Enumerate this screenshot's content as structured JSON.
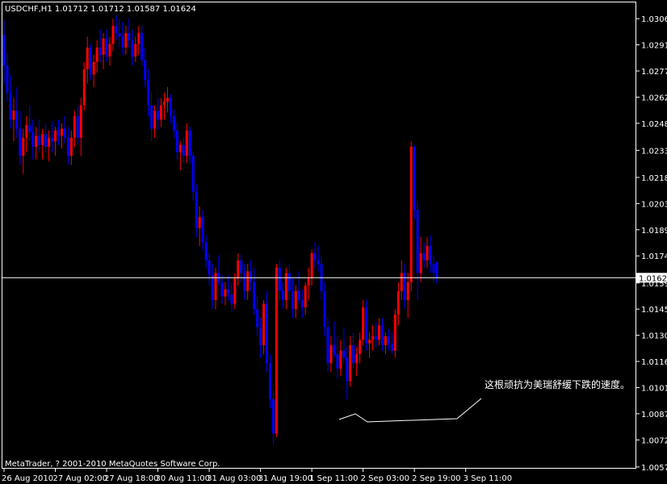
{
  "header": {
    "title": "USDCHF,H1  1.01712 1.01712 1.01587 1.01624"
  },
  "footer": {
    "copyright": "MetaTrader, ? 2001-2010 MetaQuotes Software Corp."
  },
  "annotation": {
    "text": "这根顽抗为美瑞舒缓下跌的速度。"
  },
  "colors": {
    "background": "#000000",
    "frame": "#ffffff",
    "bull": "#ff0000",
    "bear": "#0000ff",
    "bid_line": "#ffffff"
  },
  "chart_data": {
    "type": "candlestick",
    "symbol": "USDCHF",
    "timeframe": "H1",
    "quote": {
      "open": 1.01712,
      "high": 1.01712,
      "low": 1.01587,
      "close": 1.01624
    },
    "current_price_label": "1.01624",
    "ylim": [
      1.0057,
      1.0315
    ],
    "yticks": [
      "1.03060",
      "1.02915",
      "1.02770",
      "1.02625",
      "1.02480",
      "1.02330",
      "1.02180",
      "1.02035",
      "1.01890",
      "1.01745",
      "1.01595",
      "1.01450",
      "1.01305",
      "1.01160",
      "1.01015",
      "1.00870",
      "1.00725",
      "1.00575"
    ],
    "xticks": [
      "26 Aug 2010",
      "27 Aug 02:00",
      "27 Aug 18:00",
      "30 Aug 11:00",
      "31 Aug 03:00",
      "31 Aug 19:00",
      "1 Sep 11:00",
      "2 Sep 03:00",
      "2 Sep 19:00",
      "3 Sep 11:00"
    ],
    "bars_between_xticks": 16,
    "candles": [
      [
        1.0297,
        1.0305,
        1.027,
        1.028
      ],
      [
        1.028,
        1.0287,
        1.026,
        1.0265
      ],
      [
        1.0265,
        1.0275,
        1.0245,
        1.025
      ],
      [
        1.025,
        1.0262,
        1.0238,
        1.0255
      ],
      [
        1.0255,
        1.0268,
        1.024,
        1.0245
      ],
      [
        1.0245,
        1.0255,
        1.0225,
        1.023
      ],
      [
        1.023,
        1.0245,
        1.022,
        1.024
      ],
      [
        1.024,
        1.0252,
        1.0232,
        1.0247
      ],
      [
        1.0247,
        1.0258,
        1.0238,
        1.0243
      ],
      [
        1.0243,
        1.025,
        1.0228,
        1.0235
      ],
      [
        1.0235,
        1.0246,
        1.0228,
        1.0241
      ],
      [
        1.0241,
        1.025,
        1.0232,
        1.0236
      ],
      [
        1.0236,
        1.0245,
        1.0228,
        1.0242
      ],
      [
        1.0242,
        1.0248,
        1.0232,
        1.0235
      ],
      [
        1.0235,
        1.0244,
        1.0227,
        1.024
      ],
      [
        1.024,
        1.0249,
        1.0232,
        1.0238
      ],
      [
        1.0238,
        1.0246,
        1.023,
        1.0244
      ],
      [
        1.0244,
        1.025,
        1.0236,
        1.0241
      ],
      [
        1.0241,
        1.0248,
        1.0234,
        1.0245
      ],
      [
        1.0245,
        1.0252,
        1.0237,
        1.024
      ],
      [
        1.024,
        1.0246,
        1.0225,
        1.023
      ],
      [
        1.023,
        1.0244,
        1.0225,
        1.024
      ],
      [
        1.024,
        1.0255,
        1.0235,
        1.0252
      ],
      [
        1.0252,
        1.0258,
        1.0236,
        1.024
      ],
      [
        1.024,
        1.0262,
        1.023,
        1.0258
      ],
      [
        1.0258,
        1.0282,
        1.0255,
        1.0278
      ],
      [
        1.0278,
        1.0296,
        1.027,
        1.029
      ],
      [
        1.029,
        1.0292,
        1.0272,
        1.0275
      ],
      [
        1.0275,
        1.0286,
        1.0268,
        1.0282
      ],
      [
        1.0282,
        1.0294,
        1.0276,
        1.029
      ],
      [
        1.029,
        1.03,
        1.0282,
        1.0286
      ],
      [
        1.0286,
        1.0298,
        1.0278,
        1.0295
      ],
      [
        1.0295,
        1.03,
        1.0282,
        1.0285
      ],
      [
        1.0285,
        1.0296,
        1.028,
        1.0292
      ],
      [
        1.0292,
        1.0306,
        1.0288,
        1.0302
      ],
      [
        1.0302,
        1.0308,
        1.0294,
        1.0298
      ],
      [
        1.0298,
        1.0306,
        1.029,
        1.0296
      ],
      [
        1.0296,
        1.0304,
        1.0286,
        1.029
      ],
      [
        1.029,
        1.0302,
        1.0286,
        1.0298
      ],
      [
        1.0298,
        1.0306,
        1.029,
        1.0294
      ],
      [
        1.0294,
        1.03,
        1.028,
        1.0285
      ],
      [
        1.0285,
        1.0296,
        1.0282,
        1.0292
      ],
      [
        1.0292,
        1.0302,
        1.0286,
        1.0298
      ],
      [
        1.0298,
        1.0302,
        1.028,
        1.0283
      ],
      [
        1.0283,
        1.029,
        1.0268,
        1.0272
      ],
      [
        1.0272,
        1.0278,
        1.0252,
        1.0258
      ],
      [
        1.0258,
        1.0265,
        1.0238,
        1.0245
      ],
      [
        1.0245,
        1.0258,
        1.024,
        1.0255
      ],
      [
        1.0255,
        1.0262,
        1.0244,
        1.025
      ],
      [
        1.025,
        1.0262,
        1.0246,
        1.0258
      ],
      [
        1.0258,
        1.0265,
        1.025,
        1.026
      ],
      [
        1.026,
        1.0268,
        1.0254,
        1.0262
      ],
      [
        1.0262,
        1.0264,
        1.0248,
        1.0252
      ],
      [
        1.0252,
        1.0256,
        1.024,
        1.0244
      ],
      [
        1.0244,
        1.0248,
        1.0228,
        1.0232
      ],
      [
        1.0232,
        1.0238,
        1.0222,
        1.0236
      ],
      [
        1.0236,
        1.024,
        1.0226,
        1.023
      ],
      [
        1.023,
        1.0248,
        1.0226,
        1.0244
      ],
      [
        1.0244,
        1.0246,
        1.0226,
        1.023
      ],
      [
        1.023,
        1.0232,
        1.0205,
        1.021
      ],
      [
        1.021,
        1.0214,
        1.0185,
        1.019
      ],
      [
        1.019,
        1.0202,
        1.018,
        1.0196
      ],
      [
        1.0196,
        1.02,
        1.0178,
        1.0182
      ],
      [
        1.0182,
        1.0186,
        1.0168,
        1.0172
      ],
      [
        1.0172,
        1.0176,
        1.0158,
        1.0164
      ],
      [
        1.0164,
        1.017,
        1.0145,
        1.015
      ],
      [
        1.015,
        1.0168,
        1.0145,
        1.0165
      ],
      [
        1.0165,
        1.0175,
        1.0158,
        1.016
      ],
      [
        1.016,
        1.0164,
        1.0148,
        1.0152
      ],
      [
        1.0152,
        1.016,
        1.0147,
        1.0156
      ],
      [
        1.0156,
        1.0164,
        1.015,
        1.0153
      ],
      [
        1.0153,
        1.016,
        1.0143,
        1.0148
      ],
      [
        1.0148,
        1.0165,
        1.0145,
        1.0162
      ],
      [
        1.0162,
        1.0176,
        1.0158,
        1.0172
      ],
      [
        1.0172,
        1.0175,
        1.016,
        1.0165
      ],
      [
        1.0165,
        1.017,
        1.015,
        1.0155
      ],
      [
        1.0155,
        1.017,
        1.015,
        1.0166
      ],
      [
        1.0166,
        1.0172,
        1.0155,
        1.016
      ],
      [
        1.016,
        1.0168,
        1.0142,
        1.0145
      ],
      [
        1.0145,
        1.0152,
        1.013,
        1.0135
      ],
      [
        1.0135,
        1.014,
        1.0118,
        1.0125
      ],
      [
        1.0125,
        1.015,
        1.012,
        1.0148
      ],
      [
        1.0148,
        1.0155,
        1.011,
        1.0115
      ],
      [
        1.0115,
        1.012,
        1.009,
        1.0095
      ],
      [
        1.0095,
        1.01,
        1.007,
        1.0076
      ],
      [
        1.0076,
        1.017,
        1.0074,
        1.0168
      ],
      [
        1.0168,
        1.0172,
        1.015,
        1.0155
      ],
      [
        1.0155,
        1.016,
        1.0145,
        1.015
      ],
      [
        1.015,
        1.0168,
        1.0145,
        1.0165
      ],
      [
        1.0165,
        1.017,
        1.015,
        1.0155
      ],
      [
        1.0155,
        1.0162,
        1.014,
        1.0145
      ],
      [
        1.0145,
        1.0158,
        1.014,
        1.0155
      ],
      [
        1.0155,
        1.0166,
        1.0148,
        1.015
      ],
      [
        1.015,
        1.0156,
        1.014,
        1.0146
      ],
      [
        1.0146,
        1.016,
        1.0142,
        1.0158
      ],
      [
        1.0158,
        1.0168,
        1.015,
        1.0162
      ],
      [
        1.0162,
        1.0178,
        1.0158,
        1.0176
      ],
      [
        1.0176,
        1.0182,
        1.0168,
        1.0172
      ],
      [
        1.0172,
        1.018,
        1.0166,
        1.017
      ],
      [
        1.017,
        1.0174,
        1.015,
        1.0155
      ],
      [
        1.0155,
        1.016,
        1.013,
        1.0135
      ],
      [
        1.0135,
        1.014,
        1.011,
        1.0115
      ],
      [
        1.0115,
        1.013,
        1.011,
        1.0125
      ],
      [
        1.0125,
        1.0138,
        1.0118,
        1.012
      ],
      [
        1.012,
        1.013,
        1.0106,
        1.0112
      ],
      [
        1.0112,
        1.0128,
        1.0108,
        1.0122
      ],
      [
        1.0122,
        1.0135,
        1.0115,
        1.0118
      ],
      [
        1.0118,
        1.0124,
        1.0095,
        1.0105
      ],
      [
        1.0105,
        1.013,
        1.0102,
        1.0125
      ],
      [
        1.0125,
        1.0132,
        1.0112,
        1.0115
      ],
      [
        1.0115,
        1.0124,
        1.0108,
        1.012
      ],
      [
        1.012,
        1.0132,
        1.0115,
        1.0128
      ],
      [
        1.0128,
        1.015,
        1.0125,
        1.0146
      ],
      [
        1.0146,
        1.015,
        1.0122,
        1.0126
      ],
      [
        1.0126,
        1.0132,
        1.0118,
        1.0128
      ],
      [
        1.0128,
        1.0136,
        1.0122,
        1.013
      ],
      [
        1.013,
        1.0138,
        1.0124,
        1.0128
      ],
      [
        1.0128,
        1.014,
        1.0125,
        1.0136
      ],
      [
        1.0136,
        1.014,
        1.0122,
        1.0125
      ],
      [
        1.0125,
        1.0132,
        1.012,
        1.013
      ],
      [
        1.013,
        1.0134,
        1.0122,
        1.0126
      ],
      [
        1.0126,
        1.0132,
        1.012,
        1.0122
      ],
      [
        1.0122,
        1.0145,
        1.0118,
        1.0142
      ],
      [
        1.0142,
        1.016,
        1.0136,
        1.0155
      ],
      [
        1.0155,
        1.0172,
        1.015,
        1.0165
      ],
      [
        1.0165,
        1.017,
        1.0145,
        1.015
      ],
      [
        1.015,
        1.0165,
        1.014,
        1.016
      ],
      [
        1.016,
        1.0238,
        1.0155,
        1.0235
      ],
      [
        1.0235,
        1.0236,
        1.0195,
        1.02
      ],
      [
        1.02,
        1.0205,
        1.015,
        1.0165
      ],
      [
        1.0165,
        1.0185,
        1.016,
        1.0176
      ],
      [
        1.0176,
        1.0182,
        1.0168,
        1.0172
      ],
      [
        1.0172,
        1.0185,
        1.0168,
        1.018
      ],
      [
        1.018,
        1.0186,
        1.0165,
        1.017
      ],
      [
        1.017,
        1.0175,
        1.016,
        1.0165
      ],
      [
        1.0171,
        1.0171,
        1.0159,
        1.0162
      ]
    ]
  }
}
